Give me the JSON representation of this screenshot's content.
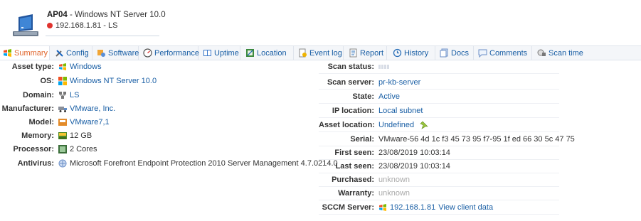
{
  "header": {
    "asset_name": "AP04",
    "title_rest": " - Windows NT Server 10.0",
    "ip_domain": "192.168.1.81 - LS"
  },
  "tabs": [
    {
      "label": "Summary",
      "icon": "windows-flag-icon",
      "active": true
    },
    {
      "label": "Config",
      "icon": "wrench-icon"
    },
    {
      "label": "Software",
      "icon": "software-icon"
    },
    {
      "label": "Performance",
      "icon": "gauge-icon"
    },
    {
      "label": "Uptime",
      "icon": "book-icon"
    },
    {
      "label": "Location",
      "icon": "location-map-icon"
    },
    {
      "label": "Event log",
      "icon": "event-log-icon"
    },
    {
      "label": "Report",
      "icon": "report-icon"
    },
    {
      "label": "History",
      "icon": "history-icon"
    },
    {
      "label": "Docs",
      "icon": "docs-icon"
    },
    {
      "label": "Comments",
      "icon": "comments-icon"
    },
    {
      "label": "Scan time",
      "icon": "scan-time-icon"
    }
  ],
  "left": [
    {
      "label": "Asset type:",
      "value": "Windows",
      "icon": "windows-flag-icon"
    },
    {
      "label": "OS:",
      "value": "Windows NT Server 10.0",
      "icon": "windows-logo-icon"
    },
    {
      "label": "Domain:",
      "value": "LS",
      "icon": "domain-icon"
    },
    {
      "label": "Manufacturer:",
      "value": "VMware, Inc.",
      "icon": "truck-icon"
    },
    {
      "label": "Model:",
      "value": "VMware7,1",
      "icon": "model-icon"
    },
    {
      "label": "Memory:",
      "value": "12 GB",
      "icon": "memory-icon"
    },
    {
      "label": "Processor:",
      "value": "2 Cores",
      "icon": "processor-icon"
    },
    {
      "label": "Antivirus:",
      "value": "Microsoft Forefront Endpoint Protection 2010 Server Management 4.7.0214.0",
      "icon": "antivirus-icon"
    }
  ],
  "right": [
    {
      "label": "Scan status:",
      "value": "",
      "kind": "status"
    },
    {
      "label": "Scan server:",
      "value": "pr-kb-server",
      "kind": "link"
    },
    {
      "label": "State:",
      "value": "Active",
      "kind": "link"
    },
    {
      "label": "IP location:",
      "value": "Local subnet",
      "kind": "link"
    },
    {
      "label": "Asset location:",
      "value": "Undefined",
      "kind": "pin"
    },
    {
      "label": "Serial:",
      "value": "VMware-56 4d 1c f3 45 73 95 f7-95 1f ed 66 30 5c 47 75",
      "kind": "dark"
    },
    {
      "label": "First seen:",
      "value": "23/08/2019 10:03:14",
      "kind": "dark"
    },
    {
      "label": "Last seen:",
      "value": "23/08/2019 10:03:14",
      "kind": "dark"
    },
    {
      "label": "Purchased:",
      "value": "unknown",
      "kind": "grey"
    },
    {
      "label": "Warranty:",
      "value": "unknown",
      "kind": "grey"
    },
    {
      "label": "SCCM Server:",
      "value": "192.168.1.81",
      "link2": "View client data",
      "kind": "sccm"
    }
  ],
  "colors": {
    "link": "#1a5fa5",
    "active_tab": "#e0652c",
    "status_dot": "#e0332e"
  }
}
